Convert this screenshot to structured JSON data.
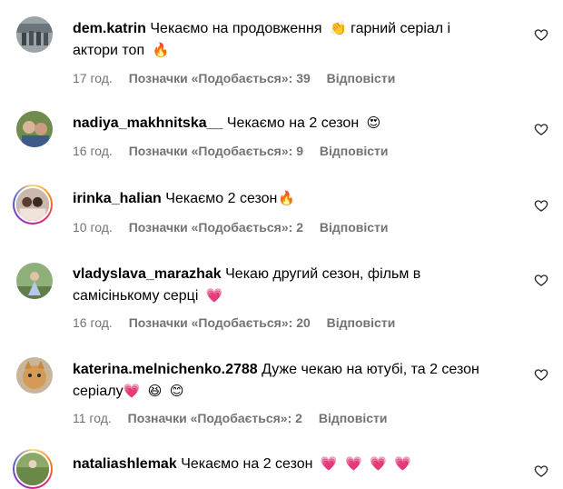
{
  "comments": [
    {
      "username": "dem.katrin",
      "text": "Чекаємо на продовження",
      "text2": "гарний серіал і",
      "line2": "актори топ",
      "time": "17 год.",
      "likes": "Позначки «Подобається»: 39",
      "reply": "Відповісти",
      "emojis": [
        "clapping-hands",
        "fire"
      ]
    },
    {
      "username": "nadiya_makhnitska__",
      "text": "Чекаємо на 2 сезон",
      "time": "16 год.",
      "likes": "Позначки «Подобається»: 9",
      "reply": "Відповісти",
      "emojis": [
        "heart-eyes"
      ]
    },
    {
      "username": "irinka_halian",
      "text": "Чекаємо 2 сезон",
      "time": "10 год.",
      "likes": "Позначки «Подобається»: 2",
      "reply": "Відповісти",
      "emojis": [
        "fire"
      ]
    },
    {
      "username": "vladyslava_marazhak",
      "text": "Чекаю другий сезон, фільм в",
      "line2": "самісінькому серці",
      "time": "16 год.",
      "likes": "Позначки «Подобається»: 20",
      "reply": "Відповісти",
      "emojis": [
        "pink-heart"
      ]
    },
    {
      "username": "katerina.melnichenko.2788",
      "text": "Дуже чекаю на ютубі, та 2 сезон",
      "line2": "серіалу",
      "time": "11 год.",
      "likes": "Позначки «Подобається»: 2",
      "reply": "Відповісти",
      "emojis": [
        "pink-heart",
        "grinning-face",
        "smiling-face"
      ]
    },
    {
      "username": "nataliashlemak",
      "text": "Чекаємо на 2 сезон",
      "emojis": [
        "pink-heart",
        "pink-heart",
        "pink-heart",
        "pink-heart"
      ]
    }
  ],
  "colors": {
    "meta_gray": "#737373",
    "text": "#000000",
    "heart_pink": "#e8306a"
  }
}
